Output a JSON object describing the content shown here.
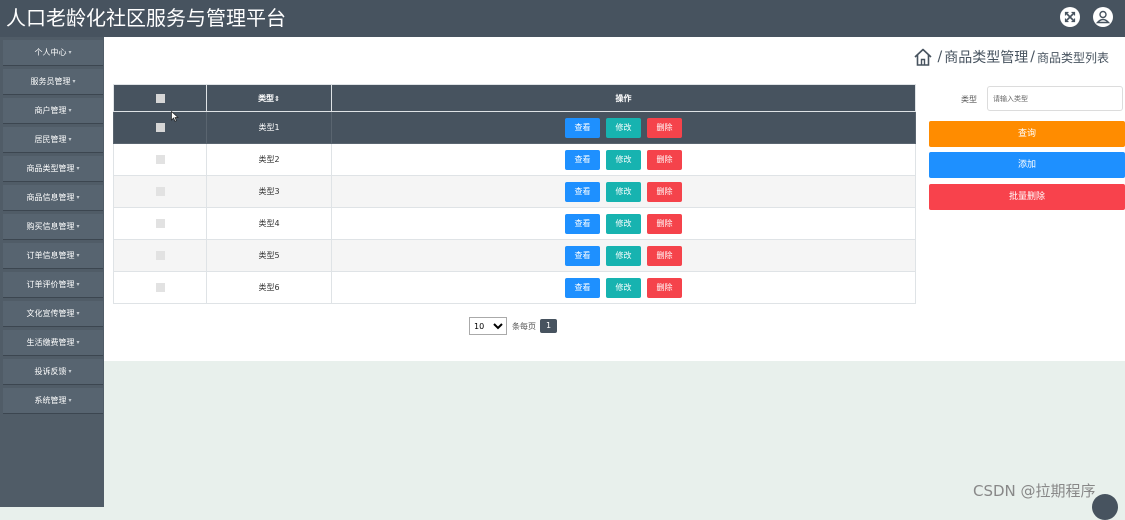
{
  "header": {
    "title": "人口老龄化社区服务与管理平台",
    "icons": [
      "fullscreen-icon",
      "user-icon"
    ]
  },
  "sidebar": {
    "items": [
      {
        "label": "个人中心"
      },
      {
        "label": "服务员管理"
      },
      {
        "label": "商户管理"
      },
      {
        "label": "居民管理"
      },
      {
        "label": "商品类型管理"
      },
      {
        "label": "商品信息管理"
      },
      {
        "label": "购买信息管理"
      },
      {
        "label": "订单信息管理"
      },
      {
        "label": "订单评价管理"
      },
      {
        "label": "文化宣传管理"
      },
      {
        "label": "生活缴费管理"
      },
      {
        "label": "投诉反馈"
      },
      {
        "label": "系统管理"
      }
    ]
  },
  "breadcrumb": {
    "section": "商品类型管理",
    "current": "商品类型列表",
    "separator": "/"
  },
  "table": {
    "headers": {
      "type": "类型",
      "sort_glyph": "⇕",
      "actions": "操作"
    },
    "row_labels": {
      "view": "查看",
      "edit": "修改",
      "delete": "删除"
    },
    "rows": [
      {
        "type": "类型1"
      },
      {
        "type": "类型2"
      },
      {
        "type": "类型3"
      },
      {
        "type": "类型4"
      },
      {
        "type": "类型5"
      },
      {
        "type": "类型6"
      }
    ]
  },
  "pagination": {
    "page_size": "10",
    "per_page_label": "条每页",
    "current_page": "1"
  },
  "search": {
    "label": "类型",
    "placeholder": "请输入类型",
    "query_button": "查询",
    "add_button": "添加",
    "batch_delete_button": "批量删除"
  },
  "watermark": "CSDN @拉期程序",
  "colors": {
    "primary_dark": "#47535f",
    "view_blue": "#1e90ff",
    "edit_teal": "#17b3b0",
    "delete_red": "#f5434b",
    "query_orange": "#ff8c00"
  }
}
